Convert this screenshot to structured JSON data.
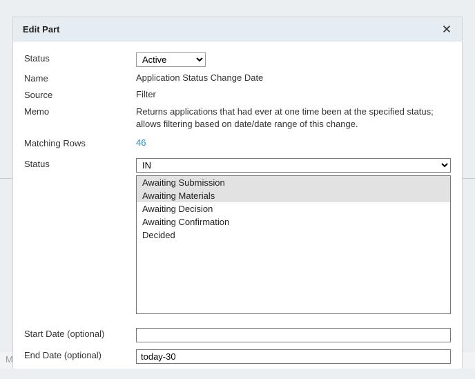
{
  "modal": {
    "title": "Edit Part"
  },
  "form": {
    "labels": {
      "status_top": "Status",
      "name": "Name",
      "source": "Source",
      "memo": "Memo",
      "matching_rows": "Matching Rows",
      "status": "Status",
      "start_date": "Start Date (optional)",
      "end_date": "End Date (optional)"
    },
    "values": {
      "status_top_selected": "Active",
      "name": "Application Status Change Date",
      "source": "Filter",
      "memo": "Returns applications that had ever at one time been at the specified status; allows filtering based on date/date range of this change.",
      "matching_rows": "46",
      "status_selected": "IN",
      "start_date": "",
      "end_date": "today-30"
    },
    "status_options": [
      "Awaiting Submission",
      "Awaiting Materials",
      "Awaiting Decision",
      "Awaiting Confirmation",
      "Decided"
    ],
    "status_selected_indices": [
      0,
      1
    ]
  },
  "bottom_panel_partial": "M"
}
